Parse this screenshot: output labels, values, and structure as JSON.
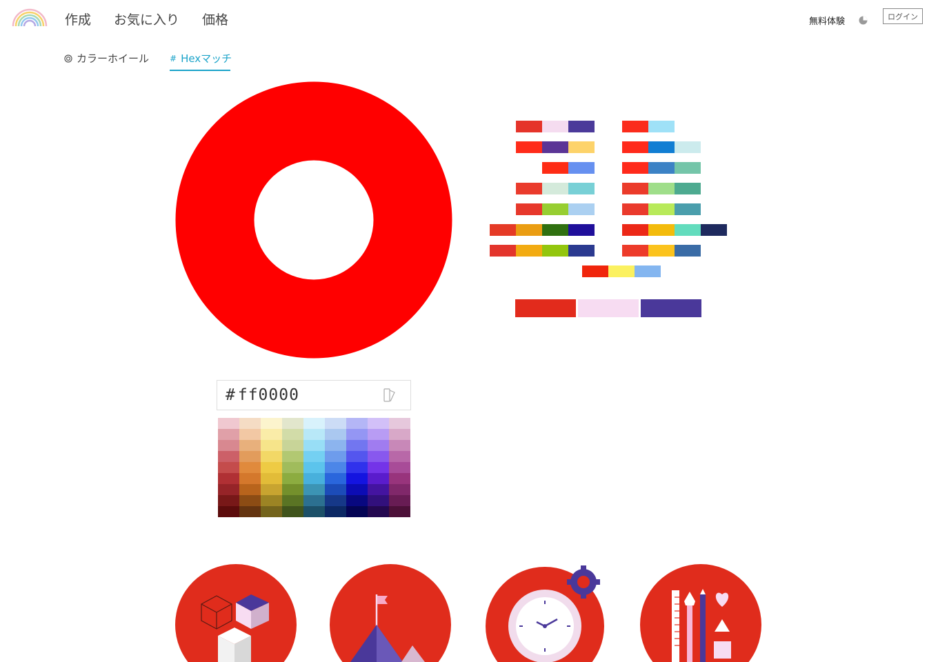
{
  "nav": {
    "items": [
      "作成",
      "お気に入り",
      "価格"
    ]
  },
  "header_right": {
    "trial_label": "無料体験",
    "login_label": "ログイン"
  },
  "subtabs": [
    {
      "icon": "target-icon",
      "label": "カラーホイール",
      "active": false
    },
    {
      "icon": "hash-icon",
      "label": "Hexマッチ",
      "active": true
    }
  ],
  "colors": {
    "accent": "#1aa3c9",
    "wheel": "#ff0000",
    "brand_red": "#e03020"
  },
  "hex_input": {
    "hash": "#",
    "value": "ff0000"
  },
  "palettes_left": [
    [
      "#e5342a",
      "#f5dcf0",
      "#4b3a9a"
    ],
    [
      "#ff2c1a",
      "#5b3596",
      "#fdd36a"
    ],
    [
      "#fe2c15",
      "#6690f0"
    ],
    [
      "#ea3b2c",
      "#d4eadb",
      "#78d0d6"
    ],
    [
      "#e7382b",
      "#97ce31",
      "#abd0f1"
    ],
    [
      "#e53a26",
      "#ea9d12",
      "#2f7010",
      "#1f0f9b"
    ],
    [
      "#e3352c",
      "#f2ab12",
      "#93c60e",
      "#2b3a90"
    ]
  ],
  "palettes_right": [
    [
      "#fb2c1c",
      "#9fe1f7"
    ],
    [
      "#ff2a1b",
      "#117ed3",
      "#ccebed"
    ],
    [
      "#ff2a1b",
      "#3c82c5",
      "#74c5a9"
    ],
    [
      "#eb3b2a",
      "#9fde8a",
      "#4daa90"
    ],
    [
      "#ea3a2c",
      "#b8ea5a",
      "#4a9eac"
    ],
    [
      "#ec2817",
      "#f3bb0c",
      "#62dcbd",
      "#1e2a5e"
    ],
    [
      "#ed3b2a",
      "#fbc31d",
      "#3a6ca6"
    ]
  ],
  "palette_center": [
    "#f0250c",
    "#fbf160",
    "#84b6f0"
  ],
  "palette_selected": [
    "#e22b1c",
    "#f7dcf2",
    "#4a389a"
  ],
  "shade_grid": [
    [
      "#f0c8d0",
      "#f5dcc4",
      "#fcf4cd",
      "#e2e6cc",
      "#d8f2fc",
      "#ccdcf6",
      "#b4b6f6",
      "#d2c0f8",
      "#e6c8dc"
    ],
    [
      "#e0a0a8",
      "#f2c8a4",
      "#faeca8",
      "#d2dca8",
      "#b8e8f8",
      "#aac8f0",
      "#9496f4",
      "#b89cf4",
      "#d8a8c8"
    ],
    [
      "#d88890",
      "#e8b07c",
      "#f6e48a",
      "#c8d498",
      "#98def6",
      "#8cb4ee",
      "#7276f0",
      "#a07cf0",
      "#c888b8"
    ],
    [
      "#cc6068",
      "#e29c5c",
      "#f2d866",
      "#b2c872",
      "#74d0f2",
      "#6e9cec",
      "#5456ee",
      "#8858ee",
      "#b868a8"
    ],
    [
      "#c44c4c",
      "#e08a3c",
      "#eecb44",
      "#a0bc5c",
      "#5cc4ec",
      "#4c86e8",
      "#3032ec",
      "#7434e8",
      "#a84c98"
    ],
    [
      "#b03034",
      "#d4782c",
      "#e2bc38",
      "#8cac40",
      "#48b0dc",
      "#2a66dc",
      "#1414e0",
      "#5a1ccc",
      "#98347c"
    ],
    [
      "#962428",
      "#b8641c",
      "#c8a430",
      "#74902c",
      "#3c94b4",
      "#1c4cb8",
      "#0c0cb4",
      "#4414a0",
      "#80286a"
    ],
    [
      "#781818",
      "#8c4c14",
      "#9c8424",
      "#5a7424",
      "#2c7090",
      "#163888",
      "#080880",
      "#32107c",
      "#681c54"
    ],
    [
      "#5c0c0c",
      "#643410",
      "#74641c",
      "#40541c",
      "#1c5068",
      "#0c2864",
      "#040454",
      "#240850",
      "#4c1038"
    ]
  ]
}
